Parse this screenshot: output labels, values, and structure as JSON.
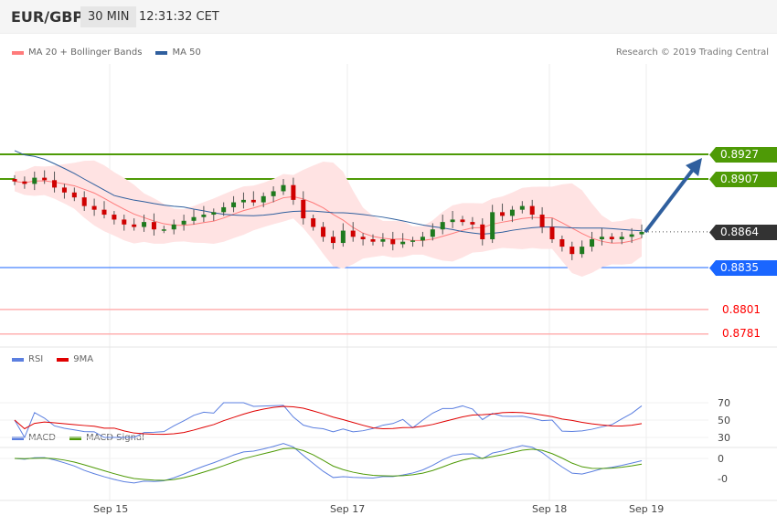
{
  "header": {
    "symbol": "EUR/GBP",
    "timeframe": "30 MIN",
    "time": "12:31:32 CET"
  },
  "legend_main": [
    {
      "label": "MA 20 + Bollinger Bands",
      "color": "#ff7b7b"
    },
    {
      "label": "MA 50",
      "color": "#2f5f9e"
    }
  ],
  "copyright": "Research © 2019 Trading Central",
  "levels": {
    "r2": "0.8927",
    "r1": "0.8907",
    "last": "0.8864",
    "s1": "0.8835",
    "s2": "0.8801",
    "s3": "0.8781"
  },
  "legend_rsi": [
    {
      "label": "RSI",
      "color": "#5b7fe0"
    },
    {
      "label": "9MA",
      "color": "#e00000"
    }
  ],
  "rsi_ticks": [
    "70",
    "50",
    "30"
  ],
  "legend_macd": [
    {
      "label": "MACD",
      "color": "#5b7fe0"
    },
    {
      "label": "MACD Signal",
      "color": "#4e9a06"
    }
  ],
  "macd_ticks": [
    "0",
    "-0"
  ],
  "x_ticks": [
    "Sep 15",
    "Sep 17",
    "Sep 18",
    "Sep 19"
  ],
  "chart_data": {
    "type": "candlestick",
    "title": "EUR/GBP 30 MIN",
    "ylim": [
      0.8775,
      0.8945
    ],
    "closes": [
      0.8905,
      0.8903,
      0.8908,
      0.8906,
      0.89,
      0.8896,
      0.8892,
      0.8885,
      0.8882,
      0.8878,
      0.8874,
      0.887,
      0.8868,
      0.8872,
      0.8866,
      0.8866,
      0.887,
      0.8873,
      0.8876,
      0.8878,
      0.888,
      0.8884,
      0.8888,
      0.889,
      0.8888,
      0.8893,
      0.8897,
      0.8902,
      0.889,
      0.8875,
      0.8868,
      0.886,
      0.8855,
      0.8865,
      0.886,
      0.8858,
      0.8856,
      0.8858,
      0.8854,
      0.8856,
      0.8857,
      0.886,
      0.8866,
      0.8872,
      0.8874,
      0.8872,
      0.887,
      0.8858,
      0.888,
      0.8877,
      0.8882,
      0.8885,
      0.8878,
      0.8868,
      0.8858,
      0.8852,
      0.8846,
      0.8852,
      0.8858,
      0.886,
      0.8858,
      0.886,
      0.8862,
      0.8864
    ],
    "forecast_target": 0.8927
  }
}
